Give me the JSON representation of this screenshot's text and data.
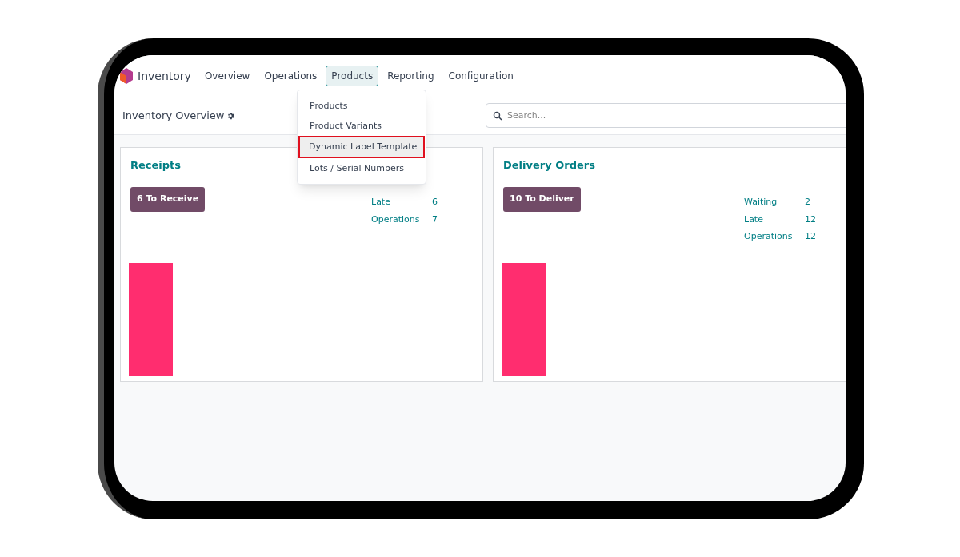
{
  "navbar": {
    "app_name": "Inventory",
    "menu": [
      {
        "label": "Overview",
        "selected": false
      },
      {
        "label": "Operations",
        "selected": false
      },
      {
        "label": "Products",
        "selected": true
      },
      {
        "label": "Reporting",
        "selected": false
      },
      {
        "label": "Configuration",
        "selected": false
      }
    ]
  },
  "dropdown": {
    "items": [
      {
        "label": "Products",
        "highlighted": false
      },
      {
        "label": "Product Variants",
        "highlighted": false
      },
      {
        "label": "Dynamic Label Template",
        "highlighted": true
      },
      {
        "label": "Lots / Serial Numbers",
        "highlighted": false
      }
    ]
  },
  "page_title": "Inventory Overview",
  "search": {
    "placeholder": "Search..."
  },
  "cards": [
    {
      "title": "Receipts",
      "action": "6 To Receive",
      "stats": [
        {
          "label": "Late",
          "value": "6"
        },
        {
          "label": "Operations",
          "value": "7"
        }
      ]
    },
    {
      "title": "Delivery Orders",
      "action": "10 To Deliver",
      "stats": [
        {
          "label": "Waiting",
          "value": "2"
        },
        {
          "label": "Late",
          "value": "12"
        },
        {
          "label": "Operations",
          "value": "12"
        }
      ]
    }
  ]
}
